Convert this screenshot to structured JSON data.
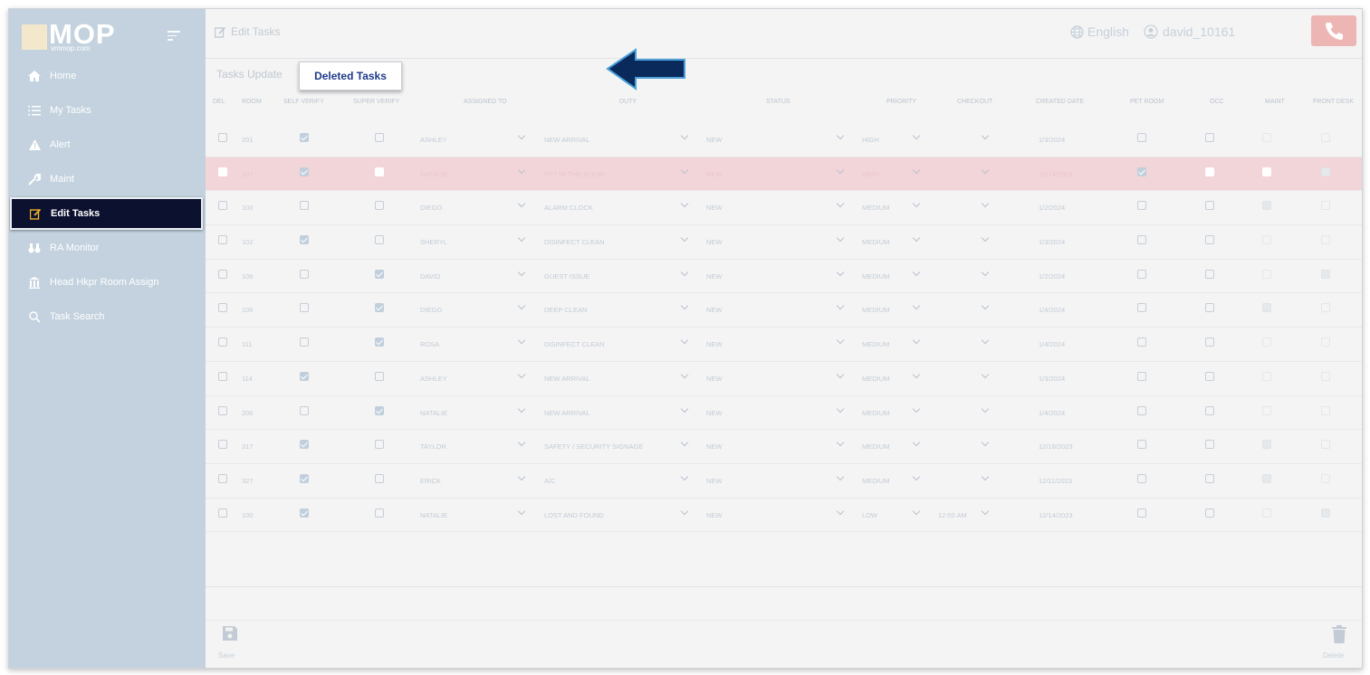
{
  "sidebar": {
    "logo": {
      "text": "MOP",
      "subtext": "vmmop.com"
    },
    "items": [
      {
        "label": "Home",
        "icon": "home-icon"
      },
      {
        "label": "My Tasks",
        "icon": "list-icon"
      },
      {
        "label": "Alert",
        "icon": "alert-icon"
      },
      {
        "label": "Maint",
        "icon": "wrench-icon"
      },
      {
        "label": "Edit Tasks",
        "icon": "edit-icon",
        "active": true
      },
      {
        "label": "RA Monitor",
        "icon": "binoculars-icon"
      },
      {
        "label": "Head Hkpr Room Assign",
        "icon": "building-icon"
      },
      {
        "label": "Task Search",
        "icon": "search-icon"
      }
    ]
  },
  "header": {
    "title": "Edit Tasks",
    "language": "English",
    "username": "david_10161"
  },
  "tabs": {
    "update": "Tasks Update",
    "deleted": "Deleted Tasks"
  },
  "table": {
    "columns": [
      "DEL",
      "ROOM",
      "SELF VERIFY",
      "SUPER VERIFY",
      "ASSIGNED TO",
      "DUTY",
      "STATUS",
      "PRIORITY",
      "CHECKOUT",
      "CREATED DATE",
      "PET ROOM",
      "OCC",
      "MAINT",
      "FRONT DESK"
    ],
    "rows": [
      {
        "room": "201",
        "self": true,
        "super": false,
        "assigned": "ASHLEY",
        "duty": "NEW ARRIVAL",
        "status": "NEW",
        "priority": "HIGH",
        "checkout": "",
        "created": "1/3/2024",
        "pet": false,
        "occ": false,
        "maint": false,
        "front": false
      },
      {
        "room": "207",
        "self": true,
        "super": false,
        "assigned": "NATALIE",
        "duty": "PET IN THE ROOM",
        "status": "NEW",
        "priority": "HIGH",
        "checkout": "",
        "created": "12/14/2023",
        "pet": true,
        "occ": false,
        "maint": false,
        "front": true,
        "highlight": true
      },
      {
        "room": "100",
        "self": false,
        "super": false,
        "assigned": "DIEGO",
        "duty": "ALARM CLOCK",
        "status": "NEW",
        "priority": "MEDIUM",
        "checkout": "",
        "created": "1/2/2024",
        "pet": false,
        "occ": false,
        "maint": true,
        "front": false
      },
      {
        "room": "102",
        "self": true,
        "super": false,
        "assigned": "SHERYL",
        "duty": "DISINFECT CLEAN",
        "status": "NEW",
        "priority": "MEDIUM",
        "checkout": "",
        "created": "1/3/2024",
        "pet": false,
        "occ": false,
        "maint": false,
        "front": false
      },
      {
        "room": "106",
        "self": false,
        "super": true,
        "assigned": "DAVID",
        "duty": "GUEST ISSUE",
        "status": "NEW",
        "priority": "MEDIUM",
        "checkout": "",
        "created": "1/2/2024",
        "pet": false,
        "occ": false,
        "maint": false,
        "front": true
      },
      {
        "room": "106",
        "self": false,
        "super": true,
        "assigned": "DIEGO",
        "duty": "DEEP CLEAN",
        "status": "NEW",
        "priority": "MEDIUM",
        "checkout": "",
        "created": "1/4/2024",
        "pet": false,
        "occ": false,
        "maint": true,
        "front": false
      },
      {
        "room": "111",
        "self": false,
        "super": true,
        "assigned": "ROSA",
        "duty": "DISINFECT CLEAN",
        "status": "NEW",
        "priority": "MEDIUM",
        "checkout": "",
        "created": "1/4/2024",
        "pet": false,
        "occ": false,
        "maint": false,
        "front": false
      },
      {
        "room": "114",
        "self": true,
        "super": false,
        "assigned": "ASHLEY",
        "duty": "NEW ARRIVAL",
        "status": "NEW",
        "priority": "MEDIUM",
        "checkout": "",
        "created": "1/3/2024",
        "pet": false,
        "occ": false,
        "maint": false,
        "front": false
      },
      {
        "room": "206",
        "self": false,
        "super": true,
        "assigned": "NATALIE",
        "duty": "NEW ARRIVAL",
        "status": "NEW",
        "priority": "MEDIUM",
        "checkout": "",
        "created": "1/4/2024",
        "pet": false,
        "occ": false,
        "maint": false,
        "front": false
      },
      {
        "room": "317",
        "self": true,
        "super": false,
        "assigned": "TAYLOR",
        "duty": "SAFETY / SECURITY SIGNAGE",
        "status": "NEW",
        "priority": "MEDIUM",
        "checkout": "",
        "created": "12/18/2023",
        "pet": false,
        "occ": false,
        "maint": true,
        "front": false
      },
      {
        "room": "327",
        "self": true,
        "super": false,
        "assigned": "ERICK",
        "duty": "A/C",
        "status": "NEW",
        "priority": "MEDIUM",
        "checkout": "",
        "created": "12/11/2023",
        "pet": false,
        "occ": false,
        "maint": true,
        "front": false
      },
      {
        "room": "100",
        "self": true,
        "super": false,
        "assigned": "NATALIE",
        "duty": "LOST AND FOUND",
        "status": "NEW",
        "priority": "LOW",
        "checkout": "12:00 AM",
        "created": "12/14/2023",
        "pet": false,
        "occ": false,
        "maint": false,
        "front": true
      }
    ]
  },
  "footer": {
    "save": "Save",
    "delete": "Delete"
  },
  "colors": {
    "sidebar_bg": "#c3d2de",
    "active_item_bg": "#0d1130",
    "highlight_row": "#f2d5d8",
    "arrow_fill": "#0a2a5c",
    "phone_button": "#eeb5b5",
    "deleted_tab_text": "#1e3a8a"
  }
}
